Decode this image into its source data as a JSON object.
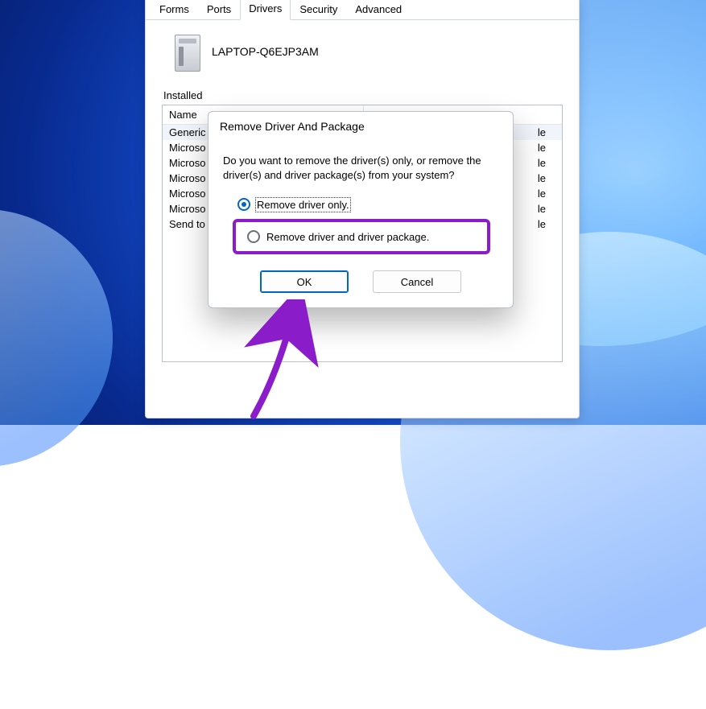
{
  "tabs": {
    "forms": "Forms",
    "ports": "Ports",
    "drivers": "Drivers",
    "security": "Security",
    "advanced": "Advanced"
  },
  "device": {
    "name": "LAPTOP-Q6EJP3AM"
  },
  "list": {
    "label": "Installed",
    "header_name": "Name",
    "rows": [
      {
        "name": "Generic",
        "right": "le",
        "selected": true
      },
      {
        "name": "Microso",
        "right": "le",
        "selected": false
      },
      {
        "name": "Microso",
        "right": "le",
        "selected": false
      },
      {
        "name": "Microso",
        "right": "le",
        "selected": false
      },
      {
        "name": "Microso",
        "right": "le",
        "selected": false
      },
      {
        "name": "Microso",
        "right": "le",
        "selected": false
      },
      {
        "name": "Send to",
        "right": "le",
        "selected": false
      }
    ]
  },
  "dialog": {
    "title": "Remove Driver And Package",
    "message": "Do you want to remove the driver(s) only, or remove the driver(s) and driver package(s) from your system?",
    "option1": "Remove driver only.",
    "option2": "Remove driver and driver package.",
    "ok": "OK",
    "cancel": "Cancel"
  }
}
